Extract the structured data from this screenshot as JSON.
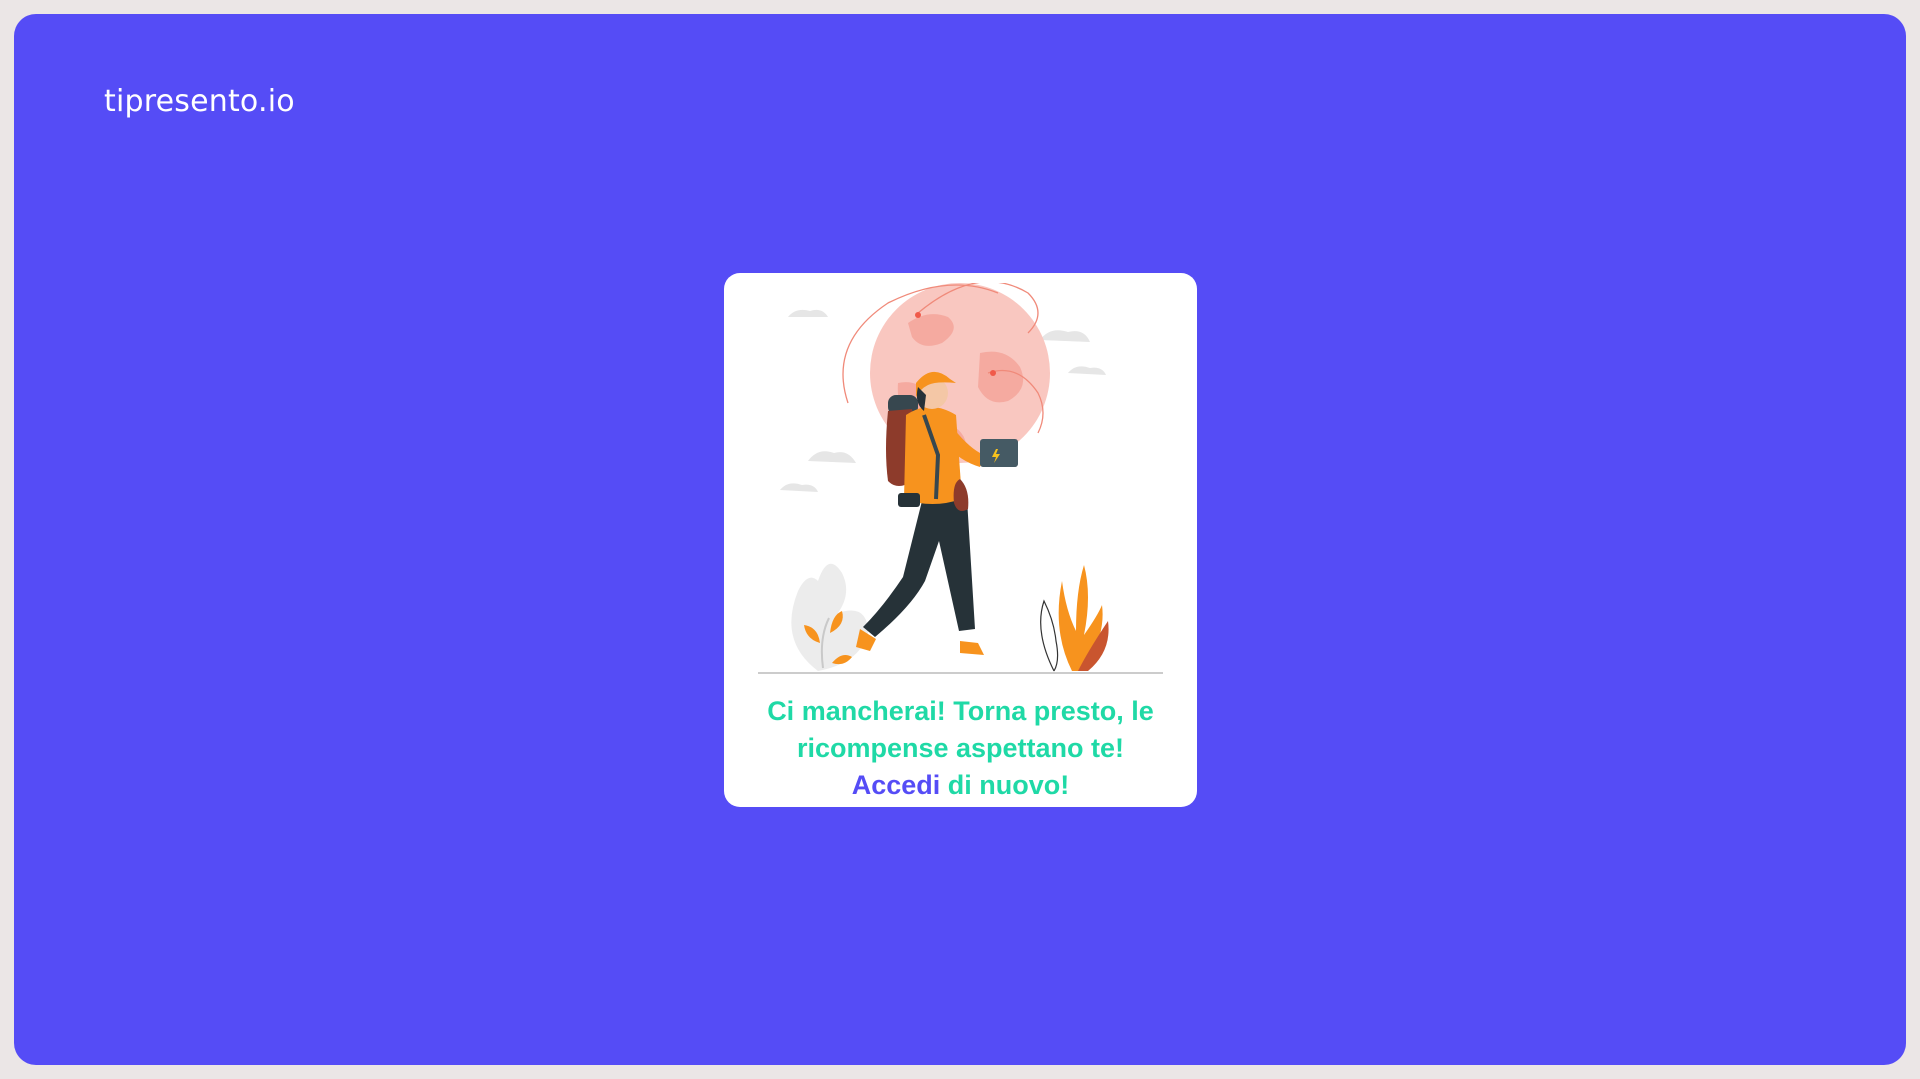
{
  "brand": {
    "logo_text": "tipresento.io"
  },
  "card": {
    "message_part1": "Ci mancherai! Torna presto, le ricompense aspettano te!",
    "login_link": "Accedi",
    "message_part2": "di nuovo!"
  },
  "colors": {
    "background": "#554cf6",
    "card": "#ffffff",
    "message": "#1fd9a6",
    "link": "#554cf6",
    "accent_orange": "#f7931e"
  },
  "illustration": {
    "icon": "traveler-with-globe-illustration"
  }
}
